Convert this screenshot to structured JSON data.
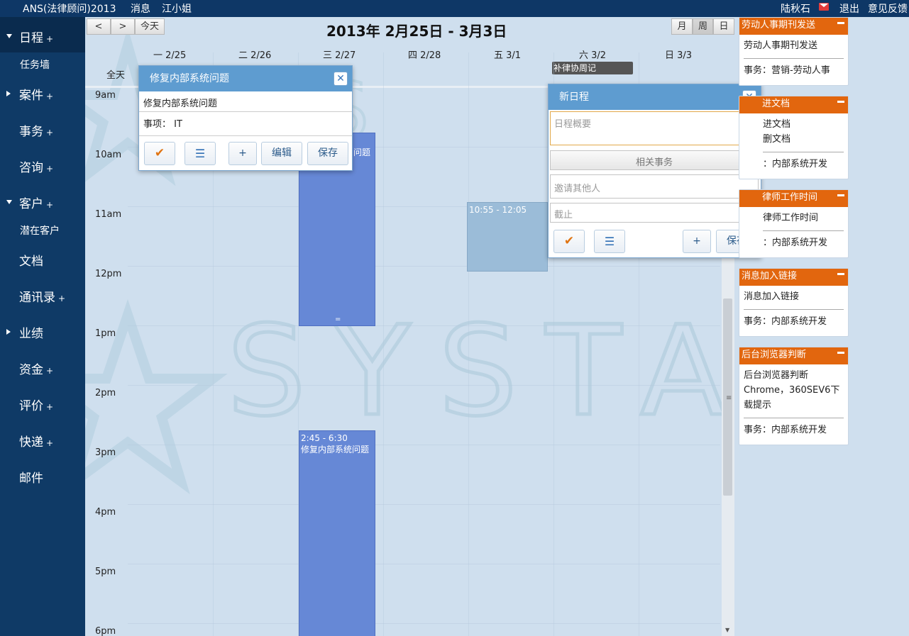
{
  "topbar": {
    "app_title": "ANS(法律顾问)2013",
    "messages": "消息",
    "user_greeting": "江小姐",
    "user_name": "陆秋石",
    "logout": "退出",
    "feedback": "意见反馈"
  },
  "sidebar": {
    "items": [
      {
        "label": "日程",
        "plus": "+"
      },
      {
        "label": "任务墙"
      },
      {
        "label": "案件",
        "plus": "+"
      },
      {
        "label": "事务",
        "plus": "+"
      },
      {
        "label": "咨询",
        "plus": "+"
      },
      {
        "label": "客户",
        "plus": "+"
      },
      {
        "label": "潜在客户"
      },
      {
        "label": "文档"
      },
      {
        "label": "通讯录",
        "plus": "+"
      },
      {
        "label": "业绩"
      },
      {
        "label": "资金",
        "plus": "+"
      },
      {
        "label": "评价",
        "plus": "+"
      },
      {
        "label": "快递",
        "plus": "+"
      },
      {
        "label": "邮件"
      }
    ]
  },
  "calendar": {
    "prev": "<",
    "next": ">",
    "today": "今天",
    "title": "2013年 2月25日 - 3月3日",
    "views": {
      "month": "月",
      "week": "周",
      "day": "日"
    },
    "days": [
      "一 2/25",
      "二 2/26",
      "三 2/27",
      "四 2/28",
      "五 3/1",
      "六 3/2",
      "日 3/3"
    ],
    "allday": "全天",
    "hours": [
      "9am",
      "10am",
      "11am",
      "12pm",
      "1pm",
      "2pm",
      "3pm",
      "4pm",
      "5pm",
      "6pm"
    ],
    "watermark": "SYSTAR",
    "allday_event": "补律协周记",
    "events": [
      {
        "time": "",
        "title": "问题"
      },
      {
        "time": "10:55 - 12:05",
        "title": ""
      },
      {
        "time": "2:45 - 6:30",
        "title": "修复内部系统问题"
      }
    ],
    "grip": "="
  },
  "popup_edit": {
    "title": "修复内部系统问题",
    "content": "修复内部系统问题",
    "matter_label": "事项：",
    "matter_value": "IT",
    "add": "+",
    "edit": "编辑",
    "save": "保存"
  },
  "popup_new": {
    "title": "新日程",
    "summary_placeholder": "日程概要",
    "related_matter": "相关事务",
    "invite_placeholder": "邀请其他人",
    "deadline_placeholder": "截止",
    "add": "+",
    "save": "保存"
  },
  "right_panel": [
    {
      "title": "劳动人事期刊发送",
      "lines": [
        "劳动人事期刊发送"
      ],
      "matter": "事务：营销-劳动人事"
    },
    {
      "title": "进文档",
      "lines": [
        "进文档",
        "删文档"
      ],
      "matter": "：内部系统开发"
    },
    {
      "title": "律师工作时间",
      "lines": [
        "律师工作时间"
      ],
      "matter": "：内部系统开发"
    },
    {
      "title": "消息加入链接",
      "lines": [
        "消息加入链接"
      ],
      "matter": "事务：内部系统开发"
    },
    {
      "title": "后台浏览器判断",
      "lines": [
        "后台浏览器判断",
        "Chrome，360SEV6下",
        "载提示"
      ],
      "matter": "事务：内部系统开发"
    }
  ],
  "colors": {
    "sidebar": "#0f3a66",
    "topbar": "#0e3766",
    "calendar_bg": "#cfdfee",
    "event_blue": "#6688d6",
    "panel_orange": "#e2660e",
    "popup_header": "#5e9cd0"
  }
}
